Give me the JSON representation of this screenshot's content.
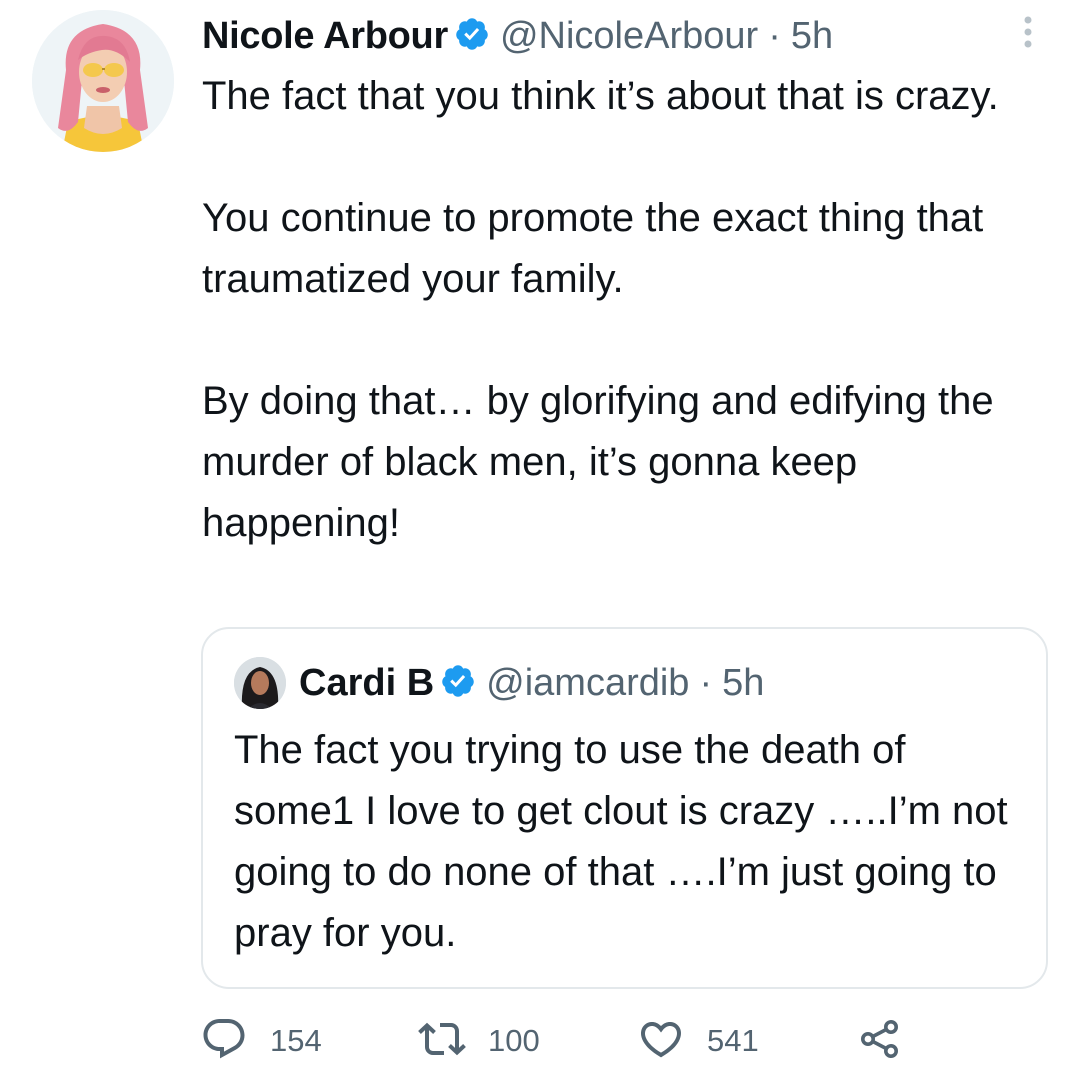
{
  "tweet": {
    "author": {
      "display_name": "Nicole Arbour",
      "handle": "@NicoleArbour",
      "separator": "·",
      "time": "5h",
      "verified": true
    },
    "text": "The fact that you think it’s about that is crazy.\n\nYou continue to promote the exact thing that traumatized your family.\n\nBy doing that… by glorifying and edifying the murder of black men, it’s gonna keep happening!",
    "quoted_tweet": {
      "author": {
        "display_name": "Cardi B",
        "handle": "@iamcardib",
        "separator": "·",
        "time": "5h",
        "verified": true
      },
      "text": "The fact you trying to use the death of some1 I love to get clout is crazy …..I’m not going to do none of that ….I’m just going to pray for you."
    },
    "actions": {
      "replies": "154",
      "retweets": "100",
      "likes": "541"
    }
  },
  "icons": {
    "verified": "verified-badge-icon",
    "more": "more-vertical-icon",
    "reply": "reply-icon",
    "retweet": "retweet-icon",
    "like": "heart-icon",
    "share": "share-icon"
  },
  "colors": {
    "text": "#0f1419",
    "secondary_text": "#536471",
    "verified_blue": "#1d9bf0",
    "border": "#e3e8eb",
    "background": "#ffffff"
  }
}
